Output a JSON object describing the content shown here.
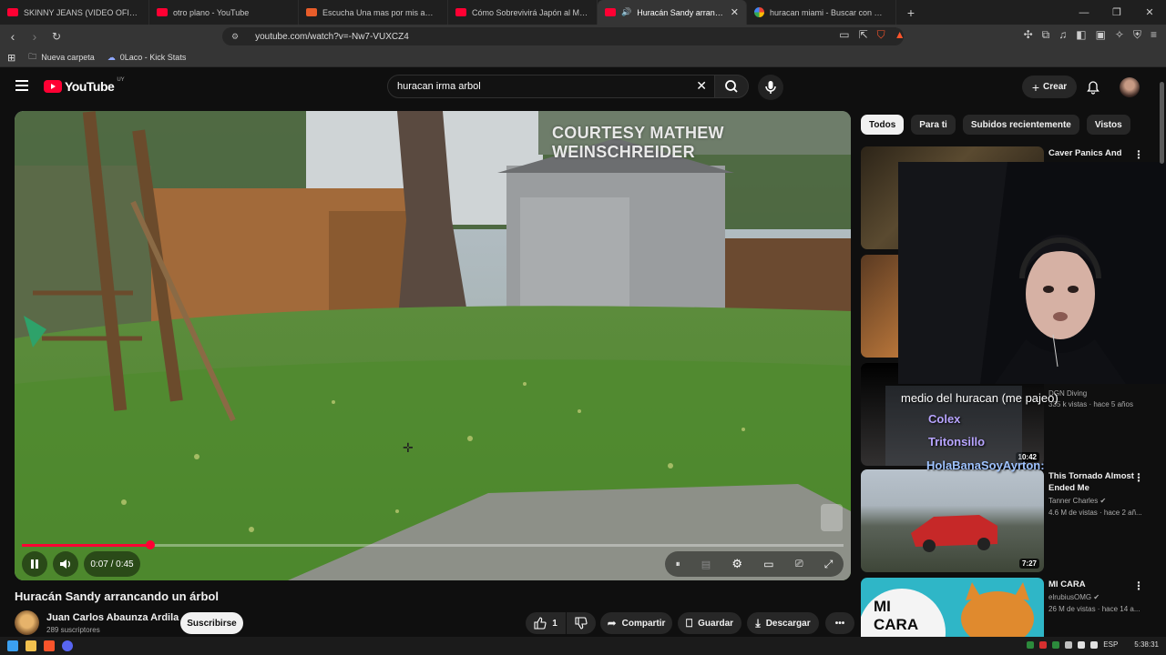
{
  "browser": {
    "tabs": [
      {
        "title": "SKINNY JEANS (VIDEO OFICIAL) - Yo",
        "icon": "youtube-icon"
      },
      {
        "title": "otro plano - YouTube",
        "icon": "youtube-icon"
      },
      {
        "title": "Escucha Una mas por mis amigos. Pr",
        "icon": "soundcloud-icon"
      },
      {
        "title": "Cómo Sobrevivirá Japón al Megaterr",
        "icon": "youtube-icon"
      },
      {
        "title": "Huracán Sandy arrancando un",
        "icon": "youtube-icon"
      },
      {
        "title": "huracan miami - Buscar con Google",
        "icon": "google-icon"
      }
    ],
    "new_tab": "+",
    "url": "youtube.com/watch?v=-Nw7-VUXCZ4",
    "bookmarks": [
      {
        "label": "Nueva carpeta",
        "icon": "folder-icon"
      },
      {
        "label": "0Laco - Kick Stats",
        "icon": "kick-icon"
      }
    ]
  },
  "youtube": {
    "logo_text": "YouTube",
    "country_code": "UY",
    "search_value": "huracan irma arbol",
    "create_label": "Crear"
  },
  "player": {
    "overlay_text": "COURTESY MATHEW WEINSCHREIDER",
    "time": "0:07 / 0:45",
    "progress": 0.156
  },
  "video": {
    "title": "Huracán Sandy arrancando un árbol",
    "channel": "Juan Carlos Abaunza Ardila",
    "subscribers": "289 suscriptores",
    "subscribe_label": "Suscribirse",
    "likes": "1",
    "share_label": "Compartir",
    "save_label": "Guardar",
    "download_label": "Descargar"
  },
  "chips": [
    "Todos",
    "Para ti",
    "Subidos recientemente",
    "Vistos"
  ],
  "recommendations": [
    {
      "title": "Caver Panics And",
      "channel": "",
      "meta": "",
      "duration": ""
    },
    {
      "title": "",
      "channel": "",
      "meta": "",
      "duration": ""
    },
    {
      "title": "",
      "channel": "DGN Diving",
      "meta": "335 k vistas · hace 5 años",
      "duration": "10:42"
    },
    {
      "title": "This Tornado Almost Ended Me",
      "channel": "Tanner Charles",
      "meta": "4.6 M de vistas · hace 2 añ...",
      "duration": "7:27"
    },
    {
      "title": "MI CARA",
      "channel": "elrubiusOMG",
      "meta": "26 M de vistas · hace 14 a...",
      "duration": ""
    }
  ],
  "thumbnail_text": {
    "mi_cara": "MI CARA"
  },
  "stream_chat": [
    "medio del huracan (me pajeo)",
    "Colex",
    "Tritonsillo",
    "HolaBanaSoyAyrton:"
  ],
  "taskbar": {
    "language": "ESP",
    "clock": "5:38:31"
  }
}
